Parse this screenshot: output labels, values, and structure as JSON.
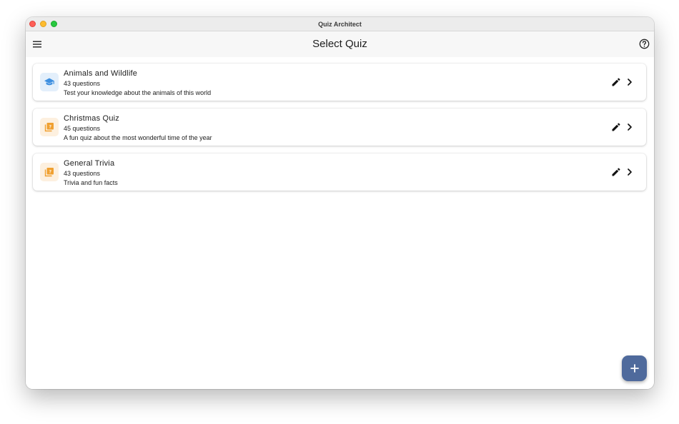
{
  "window": {
    "title": "Quiz Architect"
  },
  "appbar": {
    "title": "Select Quiz",
    "menu_icon": "menu-icon",
    "help_icon": "help-circle-icon"
  },
  "quizzes": [
    {
      "title": "Animals and Wildlife",
      "count": "43 questions",
      "description": "Test your knowledge about the animals of this world",
      "icon": "school-icon",
      "icon_color": "#3d8fe0",
      "icon_bg": "#e3effb"
    },
    {
      "title": "Christmas Quiz",
      "count": "45 questions",
      "description": "A fun quiz about the most wonderful time of the year",
      "icon": "quiz-icon",
      "icon_color": "#f0a030",
      "icon_bg": "#fdf0df"
    },
    {
      "title": "General Trivia",
      "count": "43 questions",
      "description": "Trivia and fun facts",
      "icon": "quiz-icon",
      "icon_color": "#f0a030",
      "icon_bg": "#fdf0df"
    }
  ],
  "row_actions": {
    "edit_icon": "pencil-icon",
    "open_icon": "chevron-right-icon"
  },
  "fab": {
    "icon": "plus-icon",
    "color": "#4f6a9c"
  }
}
